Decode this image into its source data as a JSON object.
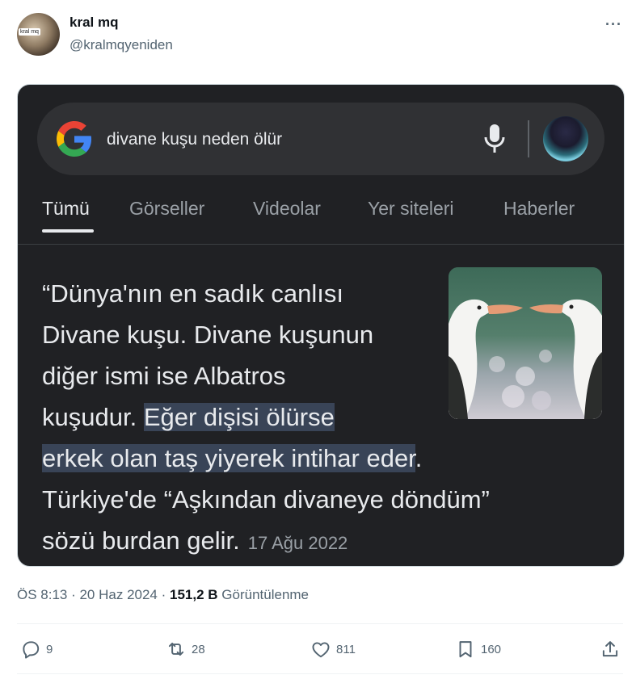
{
  "post": {
    "display_name": "kral mq",
    "handle": "@kralmqyeniden",
    "avatar_label": "kral mq",
    "more_label": "···",
    "timestamp": "ÖS 8:13 · 20 Haz 2024",
    "separator": " · ",
    "views_count": "151,2 B",
    "views_label": "Görüntülenme"
  },
  "embedded": {
    "search_query": "divane kuşu neden ölür",
    "tabs": [
      {
        "label": "Tümü",
        "active": true
      },
      {
        "label": "Görseller",
        "active": false
      },
      {
        "label": "Videolar",
        "active": false
      },
      {
        "label": "Yer siteleri",
        "active": false
      },
      {
        "label": "Haberler",
        "active": false
      }
    ],
    "snippet": {
      "line1": "“Dünya'nın en sadık canlısı",
      "line2": "Divane kuşu. Divane kuşunun",
      "line3": "diğer ismi ise Albatros",
      "line4_plain": "kuşudur. ",
      "line4_highlight": "Eğer dişisi ölürse",
      "line5_highlight": "erkek olan taş yiyerek intihar eder",
      "line5_plain": ".",
      "line6": "Türkiye'de “Aşkından divaneye döndüm”",
      "line7": "sözü burdan gelir.",
      "date": "17 Ağu 2022"
    }
  },
  "actions": {
    "replies": "9",
    "reposts": "28",
    "likes": "811",
    "bookmarks": "160"
  },
  "colors": {
    "card_bg": "#202124",
    "search_bg": "#303134",
    "highlight": "#394457",
    "muted": "#536471"
  }
}
